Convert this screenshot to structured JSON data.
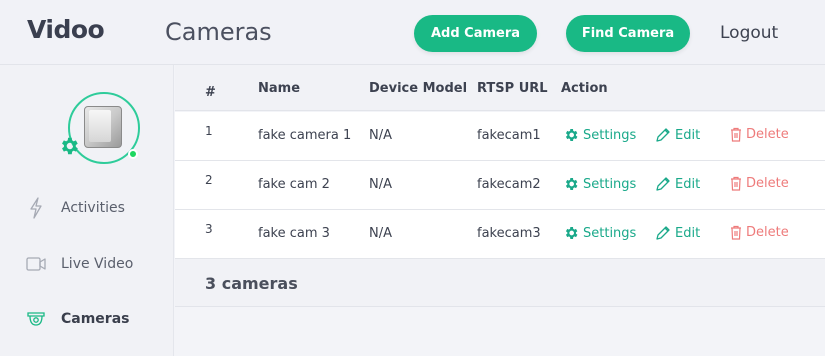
{
  "app": {
    "brand": "Vidoo",
    "page_title": "Cameras"
  },
  "header": {
    "add_camera_label": "Add Camera",
    "find_camera_label": "Find Camera",
    "logout_label": "Logout"
  },
  "sidebar": {
    "avatar": {
      "icon": "camera-device-image",
      "badge_icon": "gear-icon",
      "status": "online",
      "status_color": "#1ed760"
    },
    "items": [
      {
        "label": "Activities",
        "icon": "lightning-icon",
        "active": false
      },
      {
        "label": "Live Video",
        "icon": "video-icon",
        "active": false
      },
      {
        "label": "Cameras",
        "icon": "camera-icon",
        "active": true
      }
    ]
  },
  "table": {
    "columns": [
      "#",
      "Name",
      "Device Model",
      "RTSP URL",
      "Action"
    ],
    "rows": [
      {
        "num": "1",
        "name": "fake camera 1",
        "model": "N/A",
        "url": "fakecam1"
      },
      {
        "num": "2",
        "name": "fake cam 2",
        "model": "N/A",
        "url": "fakecam2"
      },
      {
        "num": "3",
        "name": "fake cam 3",
        "model": "N/A",
        "url": "fakecam3"
      }
    ],
    "actions": {
      "settings": "Settings",
      "edit": "Edit",
      "delete": "Delete"
    },
    "footer": "3 cameras"
  },
  "colors": {
    "accent": "#19b985",
    "delete": "#ee7b7b",
    "action": "#1aa98a"
  }
}
